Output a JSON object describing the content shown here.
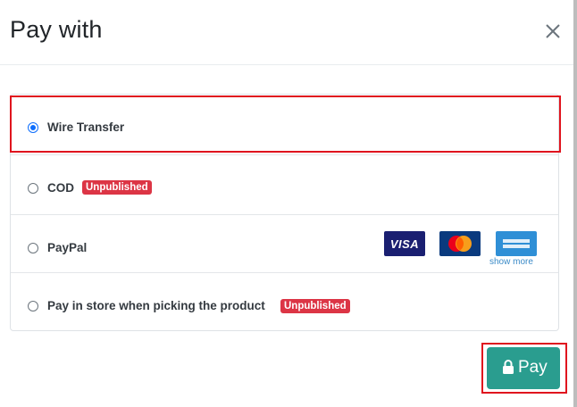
{
  "dialog": {
    "title": "Pay with"
  },
  "methods": [
    {
      "label": "Wire Transfer",
      "checked": true
    },
    {
      "label": "COD",
      "badge": "Unpublished"
    },
    {
      "label": "PayPal",
      "cards": [
        "visa-card-icon",
        "mastercard-card-icon",
        "amex-card-icon"
      ],
      "visa_text": "VISA",
      "show_more": "show more"
    },
    {
      "label": "Pay in store when picking the product",
      "badge": "Unpublished"
    }
  ],
  "pay_button": {
    "label": "Pay"
  },
  "colors": {
    "accent": "#2a9d8f",
    "badge": "#dc3545",
    "highlight": "#e0141e",
    "radio": "#0d6efd"
  }
}
